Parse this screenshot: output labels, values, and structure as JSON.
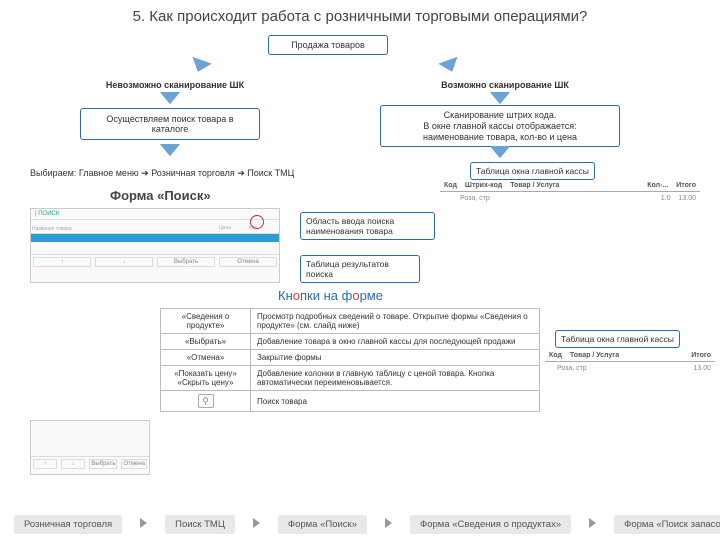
{
  "title": "5. Как происходит работа с розничными торговыми операциями?",
  "top": {
    "sale": "Продажа товаров",
    "left_label": "Невозможно сканирование ШК",
    "right_label": "Возможно сканирование ШК",
    "left_box": "Осуществляем поиск товара в каталоге",
    "right_box": "Сканирование штрих кода.\nВ окне главной кассы отображается:\nнаименование товара, кол-во и цена",
    "table_caption": "Таблица окна главной кассы",
    "path": "Выбираем: Главное меню ➔ Розничная торговля ➔ Поиск ТМЦ"
  },
  "form_search": "Форма «Поиск»",
  "callout1": "Область ввода поиска наименования товара",
  "callout2": "Таблица результатов поиска",
  "form_buttons_h": "Кнопки на форме",
  "tbl": {
    "cols": [
      "Код",
      "Штрих-код",
      "Товар / Услуга",
      "Кол-...",
      "Итого"
    ],
    "row_name": "Роза, стр",
    "row_qty": "1.0",
    "row_sum": "13.00"
  },
  "buttons": [
    {
      "name": "«Сведения о продукте»",
      "desc": "Просмотр подробных сведений о товаре. Открытие формы «Сведения о продукте» (см. слайд ниже)"
    },
    {
      "name": "«Выбрать»",
      "desc": "Добавление товара в окно главной кассы для последующей продажи"
    },
    {
      "name": "«Отмена»",
      "desc": "Закрытие формы"
    },
    {
      "name": "«Показать цену»\n«Скрыть цену»",
      "desc": "Добавление колонки в главную таблицу с ценой товара. Кнопка автоматически переименовывается."
    },
    {
      "name": "",
      "desc": "Поиск товара"
    }
  ],
  "right_caption": "Таблица окна главной кассы",
  "nav": [
    "Розничная торговля",
    "Поиск ТМЦ",
    "Форма «Поиск»",
    "Форма «Сведения о продуктах»",
    "Форма «Поиск запасов»"
  ],
  "form_mock": {
    "title": "ПОИСК",
    "b1": "↑",
    "b2": "↓",
    "b3": "Выбрать",
    "b4": "Отмена"
  }
}
